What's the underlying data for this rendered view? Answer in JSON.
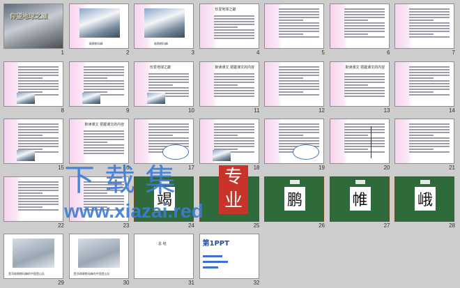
{
  "slides": [
    {
      "n": "1",
      "kind": "title",
      "title": "仰望地球之巅"
    },
    {
      "n": "2",
      "kind": "photo",
      "caption": "珠穆朗玛峰"
    },
    {
      "n": "3",
      "kind": "photo",
      "caption": "珠穆朗玛峰"
    },
    {
      "n": "4",
      "kind": "text",
      "heading": "珍爱地球之巅"
    },
    {
      "n": "5",
      "kind": "text"
    },
    {
      "n": "6",
      "kind": "text"
    },
    {
      "n": "7",
      "kind": "text"
    },
    {
      "n": "8",
      "kind": "textphoto"
    },
    {
      "n": "9",
      "kind": "textphoto"
    },
    {
      "n": "10",
      "kind": "textphoto",
      "heading": "珍爱地球之巅"
    },
    {
      "n": "11",
      "kind": "text",
      "heading": "默读课文  把握课文的内容"
    },
    {
      "n": "12",
      "kind": "text"
    },
    {
      "n": "13",
      "kind": "text",
      "heading": "默读课文  把握课文的内容"
    },
    {
      "n": "14",
      "kind": "text"
    },
    {
      "n": "15",
      "kind": "textphoto"
    },
    {
      "n": "16",
      "kind": "text",
      "heading": "默读课文  把握课文的内容"
    },
    {
      "n": "17",
      "kind": "bubble"
    },
    {
      "n": "18",
      "kind": "textphoto"
    },
    {
      "n": "19",
      "kind": "textbubble"
    },
    {
      "n": "20",
      "kind": "brace"
    },
    {
      "n": "21",
      "kind": "text"
    },
    {
      "n": "22",
      "kind": "pinkbox"
    },
    {
      "n": "23",
      "kind": "text"
    },
    {
      "n": "24",
      "kind": "board",
      "char": "竭"
    },
    {
      "n": "25",
      "kind": "board",
      "char": "业"
    },
    {
      "n": "26",
      "kind": "board",
      "char": "鹏"
    },
    {
      "n": "27",
      "kind": "board",
      "char": "帷"
    },
    {
      "n": "28",
      "kind": "board",
      "char": "峨"
    },
    {
      "n": "29",
      "kind": "people",
      "caption": "登顶珠穆朗玛峰的中国登山队"
    },
    {
      "n": "30",
      "kind": "people",
      "caption": "登顶珠穆朗玛峰的中国登山队"
    },
    {
      "n": "31",
      "kind": "heading",
      "heading": "总 结"
    },
    {
      "n": "32",
      "kind": "logo",
      "logo": "第1PPT"
    }
  ],
  "watermark": {
    "chars": "下载集",
    "site": "www.xiazai.red",
    "seal": "专业"
  }
}
